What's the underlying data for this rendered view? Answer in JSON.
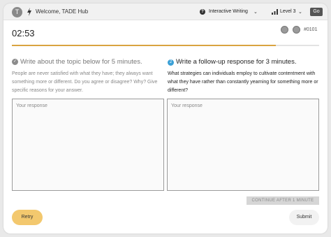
{
  "header": {
    "avatar_initial": "T",
    "welcome": "Welcome, TADE Hub",
    "mode_label": "Interactive Writing",
    "level_label": "Level 3",
    "go_label": "Go"
  },
  "timer": "02:53",
  "question_id": "#0101",
  "progress": {
    "fraction": 0.86,
    "color": "#d9a441"
  },
  "left": {
    "title": "Write about the topic below for 5 minutes.",
    "prompt": "People are never satisfied with what they have; they always want something more or different. Do you agree or disagree? Why? Give specific reasons for your answer.",
    "placeholder": "Your response"
  },
  "right": {
    "step_number": "2",
    "title": "Write a follow-up response for 3 minutes.",
    "prompt": "What strategies can individuals employ to cultivate contentment with what they have rather than constantly yearning for something more or different?",
    "placeholder": "Your response"
  },
  "continue_label": "CONTINUE AFTER 1 MINUTE",
  "retry_label": "Retry",
  "submit_label": "Submit",
  "colors": {
    "accent": "#f3c86e",
    "step_badge": "#3ba0d6"
  },
  "icons": [
    "lightning-icon",
    "question-circle-icon",
    "chevron-down-icon",
    "signal-bars-icon",
    "check-circle-icon",
    "headphones-icon",
    "settings-icon"
  ]
}
